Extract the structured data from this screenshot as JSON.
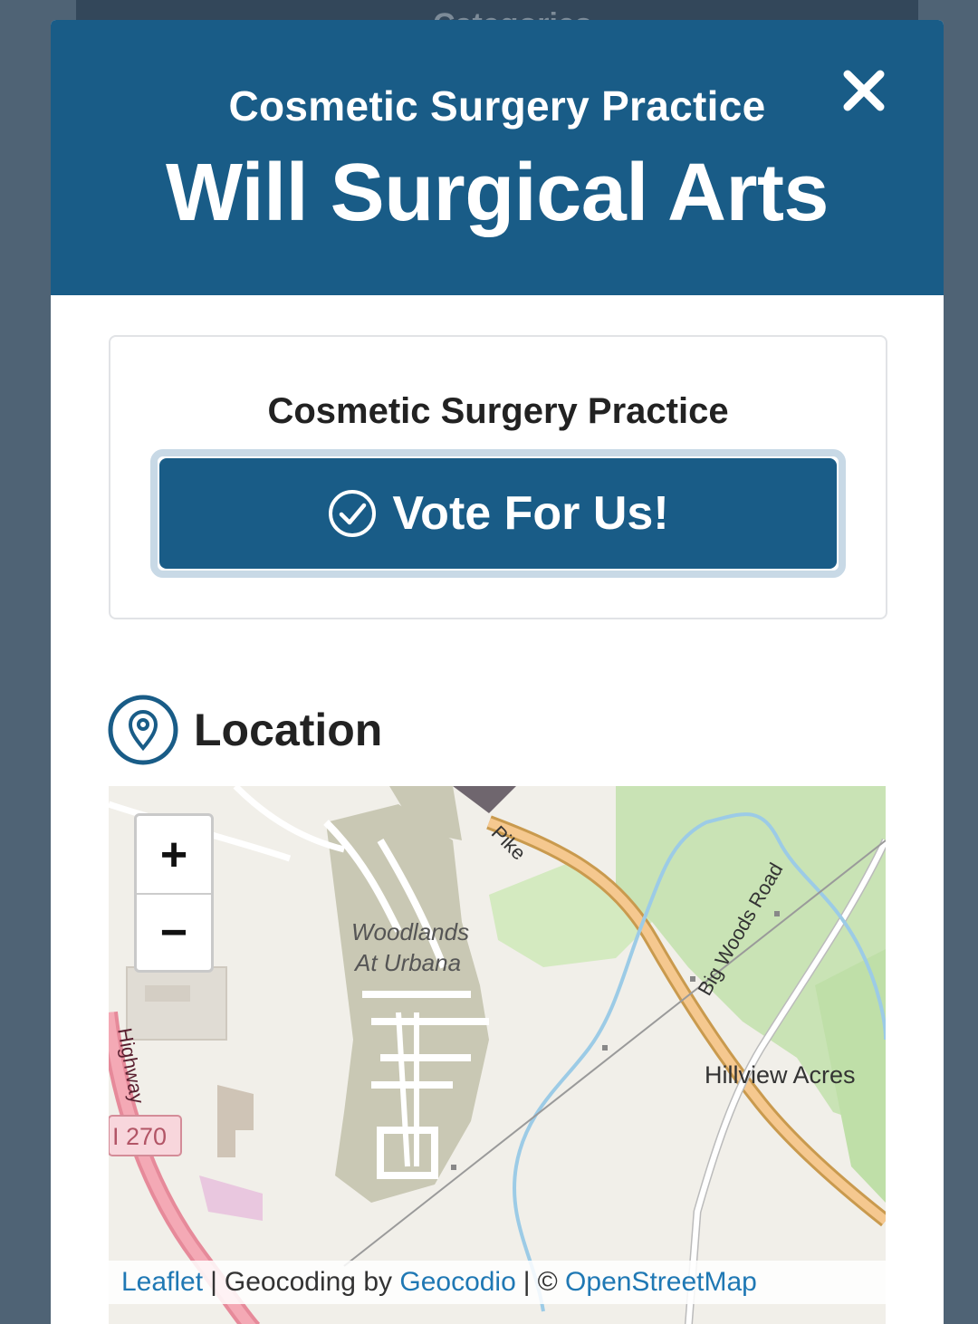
{
  "background_nav": {
    "label": "Categories"
  },
  "modal": {
    "subtitle": "Cosmetic Surgery Practice",
    "title": "Will Surgical Arts",
    "close_icon": "close-icon"
  },
  "vote_card": {
    "label": "Cosmetic Surgery Practice",
    "button_label": "Vote For Us!",
    "button_icon": "check-circle-icon"
  },
  "location": {
    "heading": "Location",
    "icon": "map-pin-icon"
  },
  "map": {
    "zoom_in": "+",
    "zoom_out": "−",
    "labels": {
      "woodlands_1": "Woodlands",
      "woodlands_2": "At Urbana",
      "pike": "Pike",
      "big_woods": "Big Woods Road",
      "hillview": "Hillview Acres",
      "highway": "Highway",
      "route": "I 270"
    },
    "attribution": {
      "leaflet": "Leaflet",
      "geocoding": "Geocoding by",
      "geocodio": "Geocodio",
      "copyright": "©",
      "osm": "OpenStreetMap",
      "separator": "|"
    }
  },
  "colors": {
    "header": "#195c87",
    "overlay": "#4f6375",
    "button_ring": "#c8d9e6",
    "link": "#1f78b4"
  }
}
